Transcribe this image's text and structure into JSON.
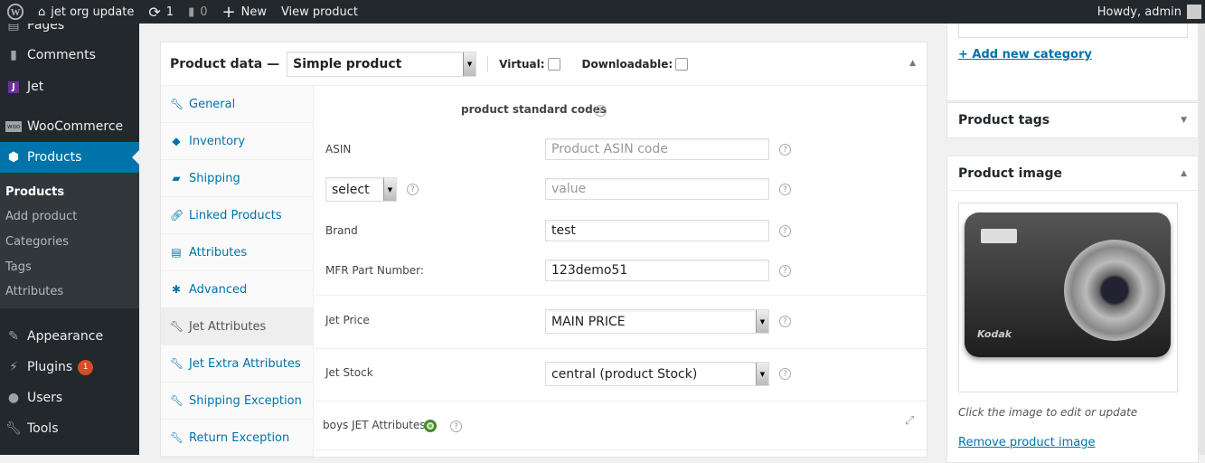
{
  "adminbar": {
    "site": "jet org update",
    "updates": "1",
    "comments": "0",
    "new": "New",
    "view": "View product",
    "howdy": "Howdy, admin"
  },
  "sidebar": {
    "items": [
      {
        "label": "Pages",
        "icon": "pages-icon"
      },
      {
        "label": "Comments",
        "icon": "comment-icon"
      },
      {
        "label": "Jet",
        "icon": "jet-icon"
      },
      {
        "label": "WooCommerce",
        "icon": "woocommerce-icon"
      },
      {
        "label": "Products",
        "icon": "box-icon"
      },
      {
        "label": "Appearance",
        "icon": "brush-icon"
      },
      {
        "label": "Plugins",
        "icon": "plug-icon",
        "badge": "1"
      },
      {
        "label": "Users",
        "icon": "user-icon"
      },
      {
        "label": "Tools",
        "icon": "wrench-icon"
      }
    ],
    "submenu": [
      "Products",
      "Add product",
      "Categories",
      "Tags",
      "Attributes"
    ]
  },
  "product_data": {
    "title": "Product data —",
    "type": "Simple product",
    "virtual": "Virtual:",
    "downloadable": "Downloadable:",
    "virtual_checked": false,
    "downloadable_checked": false,
    "tabs": [
      {
        "label": "General",
        "icon": "wrench-icon"
      },
      {
        "label": "Inventory",
        "icon": "tag-icon"
      },
      {
        "label": "Shipping",
        "icon": "truck-icon"
      },
      {
        "label": "Linked Products",
        "icon": "link-icon"
      },
      {
        "label": "Attributes",
        "icon": "list-icon"
      },
      {
        "label": "Advanced",
        "icon": "gear-icon"
      },
      {
        "label": "Jet Attributes",
        "icon": "wrench-icon",
        "active": true
      },
      {
        "label": "Jet Extra Attributes",
        "icon": "wrench-icon"
      },
      {
        "label": "Shipping Exception",
        "icon": "wrench-icon"
      },
      {
        "label": "Return Exception",
        "icon": "wrench-icon"
      }
    ],
    "section_title": "product standard codes",
    "asin_label": "ASIN",
    "asin_placeholder": "Product ASIN code",
    "code_select": "select",
    "code_value_placeholder": "value",
    "brand_label": "Brand",
    "brand_value": "test",
    "mfr_label": "MFR Part Number:",
    "mfr_value": "123demo51",
    "jet_price_label": "Jet Price",
    "jet_price_value": "MAIN PRICE",
    "jet_stock_label": "Jet Stock",
    "jet_stock_value": "central (product Stock)",
    "boys_label": "boys JET Attributes"
  },
  "right": {
    "add_category": "+ Add new category",
    "tags_title": "Product tags",
    "image_title": "Product image",
    "image_caption": "Click the image to edit or update",
    "remove_image": "Remove product image",
    "image_brand": "Kodak"
  }
}
